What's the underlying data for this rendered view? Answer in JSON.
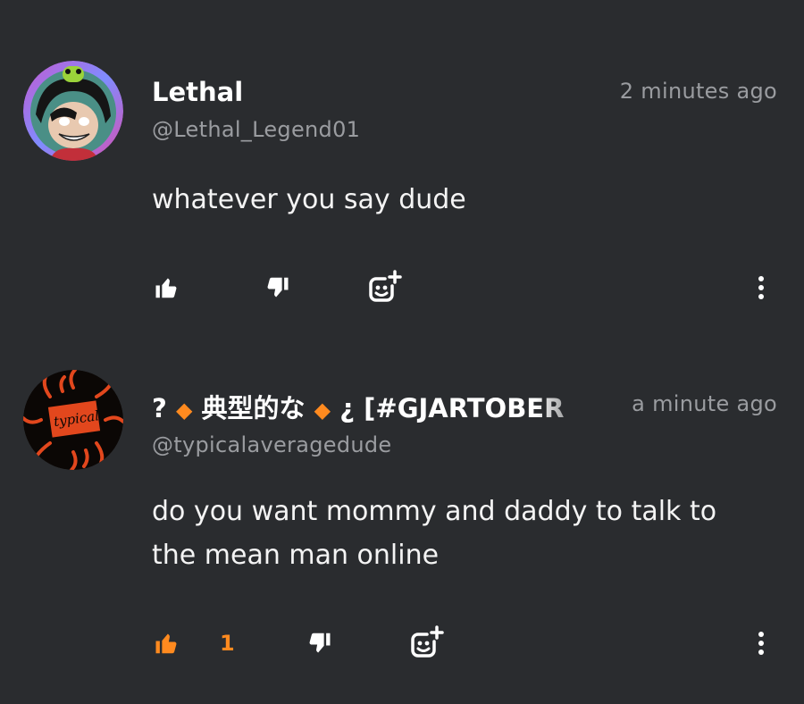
{
  "comments": [
    {
      "display_name": "Lethal",
      "handle": "@Lethal_Legend01",
      "time": "2 minutes ago",
      "text": "whatever you say dude",
      "likes": "",
      "liked": false
    },
    {
      "display_name_parts": [
        "?",
        "典型的な",
        "¿ [#GJARTOBER"
      ],
      "handle": "@typicalaveragedude",
      "time": "a minute ago",
      "text": "do you want mommy and daddy to talk to the mean man online",
      "likes": "1",
      "liked": true,
      "avatar_text": "typical"
    }
  ],
  "colors": {
    "background": "#2a2c2f",
    "accent": "#ff8a1f",
    "muted": "#9a9ca0",
    "text": "#f4f4f4"
  },
  "icons": [
    "thumbs-up-icon",
    "thumbs-down-icon",
    "add-reaction-icon",
    "more-options-icon",
    "diamond-icon"
  ]
}
